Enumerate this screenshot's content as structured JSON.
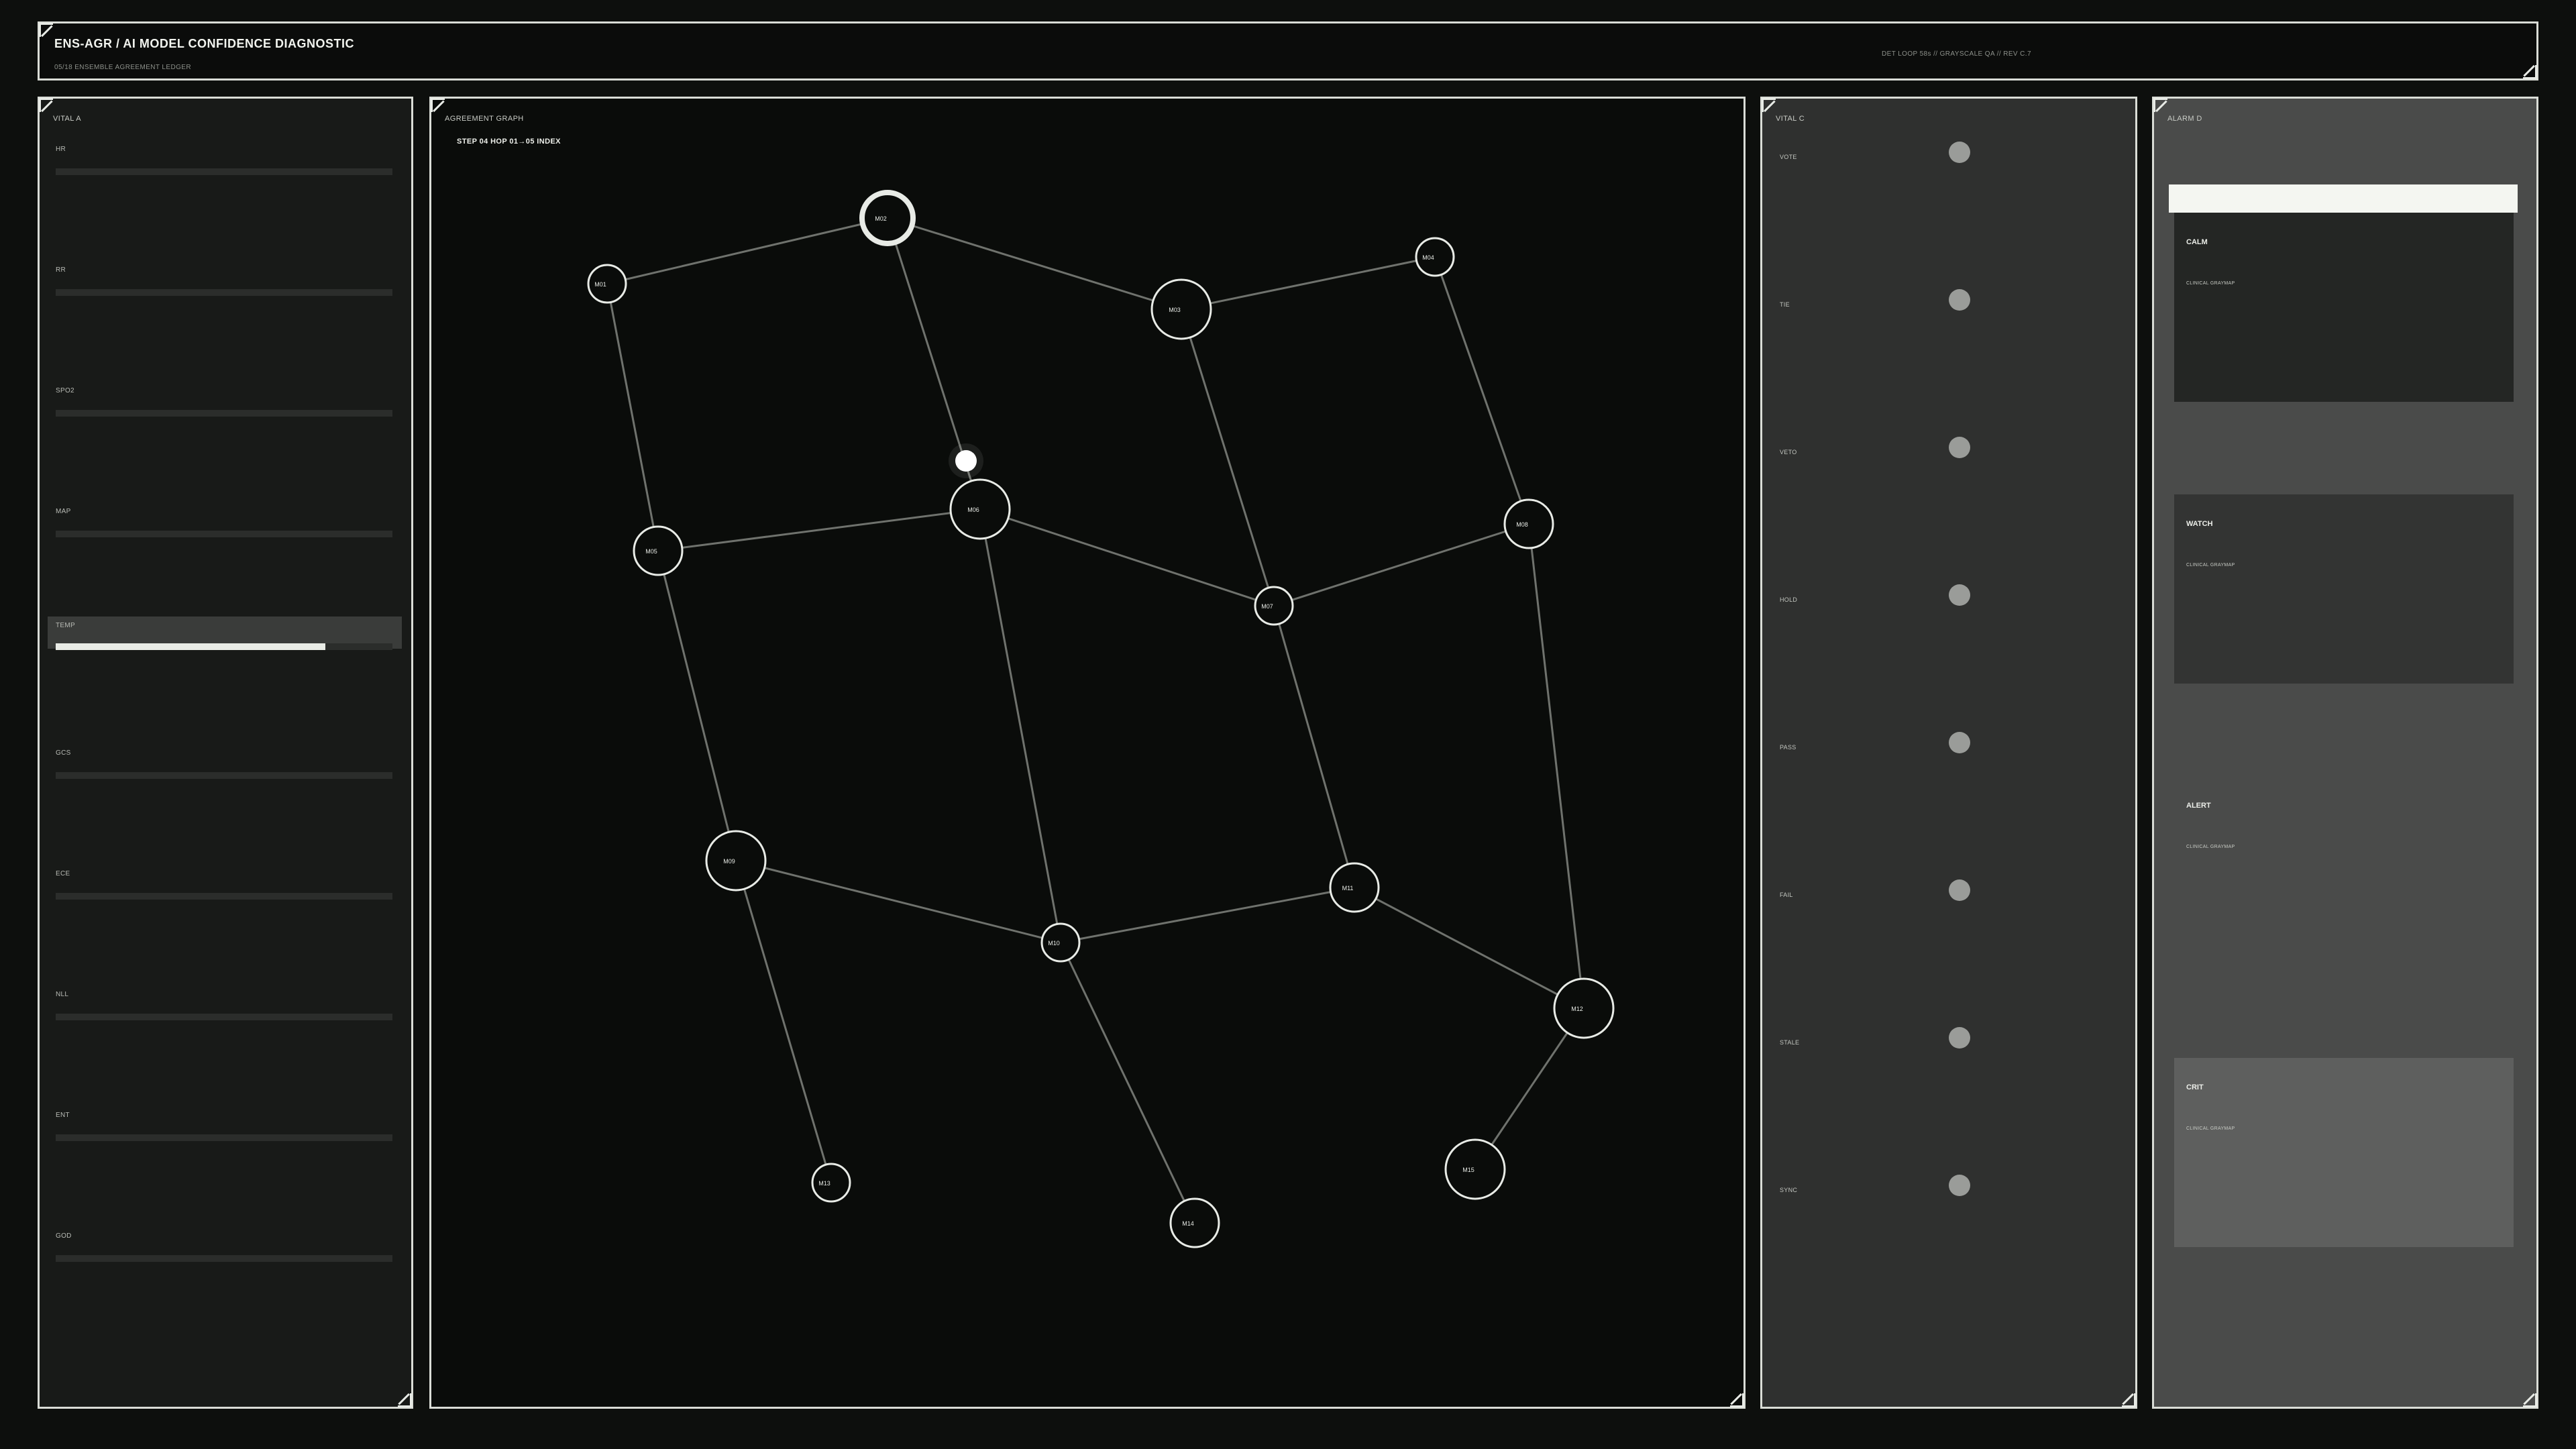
{
  "header": {
    "title": "ENS-AGR  /  AI MODEL CONFIDENCE DIAGNOSTIC",
    "subtitle": "05/18  ENSEMBLE AGREEMENT LEDGER",
    "meta": "DET LOOP 58s  //  GRAYSCALE QA  //  REV C.7"
  },
  "vital_a": {
    "label": "VITAL A",
    "rows": [
      {
        "label": "HR",
        "value": null
      },
      {
        "label": "RR",
        "value": null
      },
      {
        "label": "SPO2",
        "value": null
      },
      {
        "label": "MAP",
        "value": null
      },
      {
        "label": "TEMP",
        "value": 0.8,
        "active": true
      },
      {
        "label": "GCS",
        "value": null
      },
      {
        "label": "ECE",
        "value": null
      },
      {
        "label": "NLL",
        "value": null
      },
      {
        "label": "ENT",
        "value": null
      },
      {
        "label": "GOD",
        "value": null
      }
    ]
  },
  "graph": {
    "label": "AGREEMENT GRAPH",
    "step": "STEP 04  HOP 01→05  INDEX",
    "nodes": [
      {
        "id": "M02",
        "emph": true
      },
      {
        "id": "M01"
      },
      {
        "id": "M03"
      },
      {
        "id": "M04"
      },
      {
        "id": "M05"
      },
      {
        "id": "M06"
      },
      {
        "id": "M07"
      },
      {
        "id": "M08"
      },
      {
        "id": "M09"
      },
      {
        "id": "M10"
      },
      {
        "id": "M11"
      },
      {
        "id": "M12"
      },
      {
        "id": "M13"
      },
      {
        "id": "M14"
      },
      {
        "id": "M15"
      }
    ],
    "edges": [
      [
        "M01",
        "M02"
      ],
      [
        "M02",
        "M03"
      ],
      [
        "M03",
        "M04"
      ],
      [
        "M01",
        "M05"
      ],
      [
        "M02",
        "M06"
      ],
      [
        "M03",
        "M07"
      ],
      [
        "M04",
        "M08"
      ],
      [
        "M05",
        "M06"
      ],
      [
        "M06",
        "M07"
      ],
      [
        "M07",
        "M08"
      ],
      [
        "M05",
        "M09"
      ],
      [
        "M06",
        "M10"
      ],
      [
        "M07",
        "M11"
      ],
      [
        "M08",
        "M12"
      ],
      [
        "M09",
        "M10"
      ],
      [
        "M10",
        "M11"
      ],
      [
        "M11",
        "M12"
      ],
      [
        "M09",
        "M13"
      ],
      [
        "M10",
        "M14"
      ],
      [
        "M12",
        "M15"
      ]
    ]
  },
  "vital_c": {
    "label": "VITAL C",
    "rows": [
      {
        "label": "VOTE"
      },
      {
        "label": "TIE"
      },
      {
        "label": "VETO"
      },
      {
        "label": "HOLD"
      },
      {
        "label": "PASS"
      },
      {
        "label": "FAIL"
      },
      {
        "label": "STALE"
      },
      {
        "label": "SYNC"
      }
    ]
  },
  "alarm_d": {
    "label": "ALARM D",
    "cards": [
      {
        "title": "CALM",
        "sub": "CLINICAL GRAYMAP",
        "color": "#242624"
      },
      {
        "title": "WATCH",
        "sub": "CLINICAL GRAYMAP",
        "color": "#333433"
      },
      {
        "title": "ALERT",
        "sub": "CLINICAL GRAYMAP",
        "color": "#4a4b4a"
      },
      {
        "title": "CRIT",
        "sub": "CLINICAL GRAYMAP",
        "color": "#5e5f5e"
      }
    ]
  }
}
